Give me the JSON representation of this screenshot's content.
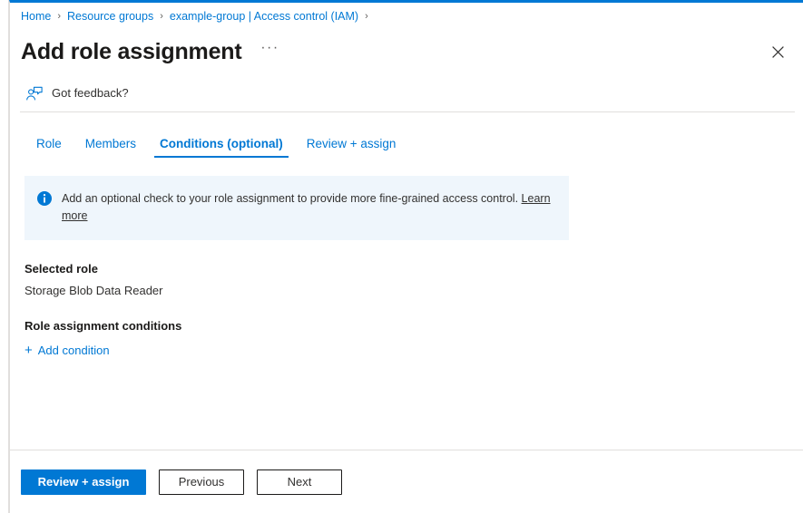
{
  "breadcrumb": {
    "separator": "›",
    "items": [
      {
        "label": "Home"
      },
      {
        "label": "Resource groups"
      },
      {
        "label": "example-group | Access control (IAM)"
      }
    ]
  },
  "header": {
    "title": "Add role assignment",
    "ellipsis_label": "···",
    "close_icon": "close-icon"
  },
  "feedback": {
    "label": "Got feedback?",
    "icon": "feedback-person-icon"
  },
  "tabs": [
    {
      "label": "Role",
      "active": false
    },
    {
      "label": "Members",
      "active": false
    },
    {
      "label": "Conditions (optional)",
      "active": true
    },
    {
      "label": "Review + assign",
      "active": false
    }
  ],
  "info_banner": {
    "icon": "info-circle-icon",
    "text": "Add an optional check to your role assignment to provide more fine-grained access control.",
    "link_label": "Learn more"
  },
  "selected_role": {
    "heading": "Selected role",
    "value": "Storage Blob Data Reader"
  },
  "conditions": {
    "heading": "Role assignment conditions",
    "add_label": "Add condition",
    "add_icon": "plus-icon"
  },
  "footer": {
    "review_assign_label": "Review + assign",
    "previous_label": "Previous",
    "next_label": "Next"
  },
  "colors": {
    "accent": "#0078d4",
    "banner_bg": "#eff6fc",
    "border": "#e1dfdd",
    "text": "#323130"
  }
}
